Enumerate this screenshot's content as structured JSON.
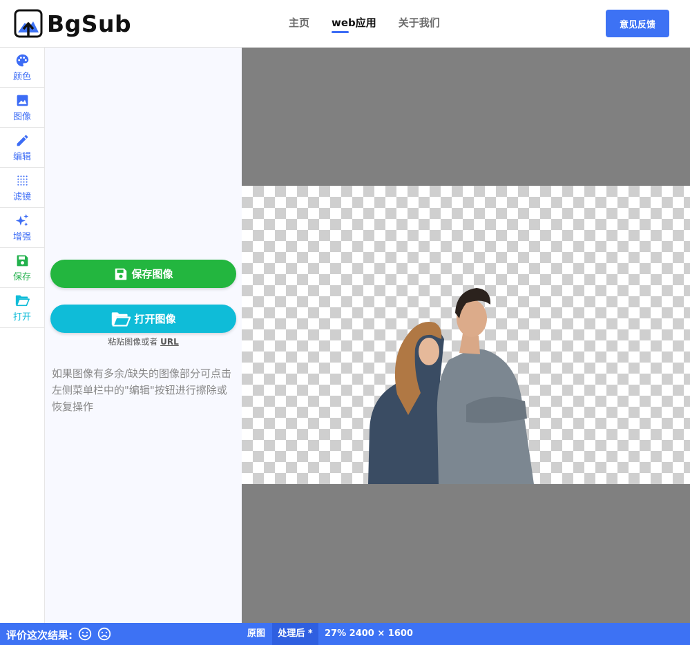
{
  "app": {
    "logo_text": "BgSub"
  },
  "nav": {
    "items": [
      {
        "label": "主页",
        "active": false
      },
      {
        "label": "web应用",
        "active": true
      },
      {
        "label": "关于我们",
        "active": false
      }
    ],
    "feedback_label": "意见反馈"
  },
  "sidebar": {
    "items": [
      {
        "label": "颜色",
        "icon": "palette-icon"
      },
      {
        "label": "图像",
        "icon": "image-icon"
      },
      {
        "label": "编辑",
        "icon": "pencil-icon"
      },
      {
        "label": "滤镜",
        "icon": "dots-grid-icon"
      },
      {
        "label": "增强",
        "icon": "sparkles-icon"
      },
      {
        "label": "保存",
        "icon": "floppy-icon"
      },
      {
        "label": "打开",
        "icon": "folder-open-icon"
      }
    ]
  },
  "panel": {
    "save_label": "保存图像",
    "open_label": "打开图像",
    "paste_hint": "粘贴图像或者",
    "paste_url": "URL",
    "tip": "如果图像有多余/缺失的图像部分可点击左侧菜单栏中的\"编辑\"按钮进行擦除或恢复操作"
  },
  "bottom": {
    "rate_label": "评价这次结果:",
    "view_original": "原图",
    "view_processed": "处理后 *",
    "zoom_info": "27% 2400 × 1600"
  },
  "colors": {
    "accent": "#3d72f4",
    "save_green": "#23b63f",
    "open_cyan": "#0fbcd8",
    "canvas_bg": "#808080"
  }
}
